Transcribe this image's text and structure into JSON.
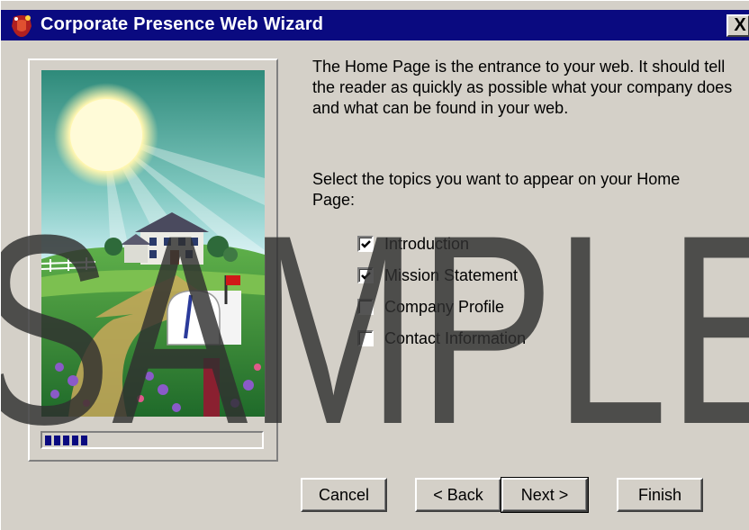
{
  "window": {
    "title": "Corporate Presence Web Wizard",
    "close_label": "X"
  },
  "wizard": {
    "progress_percent": 20,
    "description": "The Home Page is the entrance to your web. It should tell the reader as quickly as possible what your company does and what can be found in your web.",
    "prompt": "Select the topics you want to appear on your Home Page:",
    "topics": [
      {
        "label": "Introduction",
        "checked": true
      },
      {
        "label": "Mission Statement",
        "checked": true
      },
      {
        "label": "Company Profile",
        "checked": false
      },
      {
        "label": "Contact Information",
        "checked": false
      }
    ]
  },
  "buttons": {
    "cancel": "Cancel",
    "back": "< Back",
    "next": "Next >",
    "finish": "Finish"
  },
  "watermark": {
    "text": "SAMPLE",
    "color": "#303030"
  },
  "colors": {
    "titlebar": "#0a0a80",
    "face": "#d4d0c8"
  }
}
